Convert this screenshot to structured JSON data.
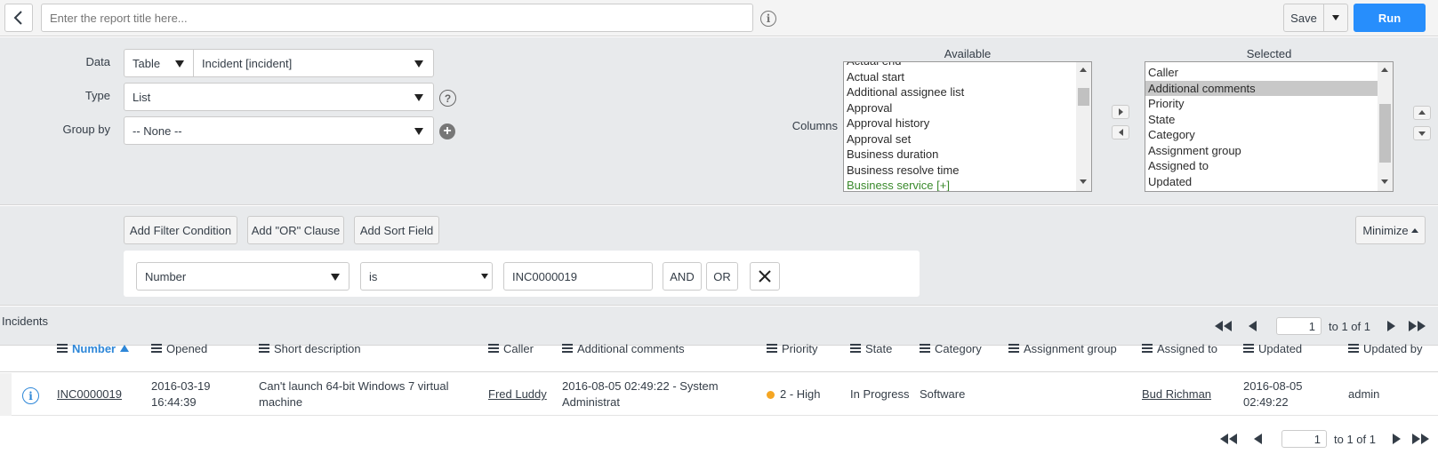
{
  "header": {
    "title_placeholder": "Enter the report title here...",
    "save_label": "Save",
    "run_label": "Run"
  },
  "colors": {
    "run_button": "#278efc",
    "priority_high": "#f5a623",
    "sort_active": "#2e87d8",
    "panel_bg": "#e8eaec"
  },
  "config": {
    "data_label": "Data",
    "data_source_type": "Table",
    "data_table": "Incident [incident]",
    "type_label": "Type",
    "type_value": "List",
    "groupby_label": "Group by",
    "groupby_value": "-- None --",
    "columns_label": "Columns",
    "available_title": "Available",
    "selected_title": "Selected",
    "available_items": [
      "Actual end",
      "Actual start",
      "Additional assignee list",
      "Approval",
      "Approval history",
      "Approval set",
      "Business duration",
      "Business resolve time",
      "Business service [+]"
    ],
    "selected_items": [
      "Caller",
      "Additional comments",
      "Priority",
      "State",
      "Category",
      "Assignment group",
      "Assigned to",
      "Updated"
    ],
    "selected_highlight": "Additional comments"
  },
  "filter": {
    "add_condition": "Add Filter Condition",
    "add_or": "Add \"OR\" Clause",
    "add_sort": "Add Sort Field",
    "minimize": "Minimize",
    "field": "Number",
    "operator": "is",
    "value": "INC0000019",
    "and_label": "AND",
    "or_label": "OR"
  },
  "list": {
    "title": "Incidents",
    "page": "1",
    "page_of": "to 1 of 1",
    "columns": [
      "Number",
      "Opened",
      "Short description",
      "Caller",
      "Additional comments",
      "Priority",
      "State",
      "Category",
      "Assignment group",
      "Assigned to",
      "Updated",
      "Updated by"
    ],
    "row": {
      "number": "INC0000019",
      "opened_date": "2016-03-19",
      "opened_time": "16:44:39",
      "short_desc_1": "Can't launch 64-bit Windows 7 virtual",
      "short_desc_2": "machine",
      "caller": "Fred Luddy",
      "comments_1": "2016-08-05 02:49:22 - System",
      "comments_2": "Administrat",
      "priority": "2 - High",
      "state": "In Progress",
      "category": "Software",
      "assignment_group": "",
      "assigned_to": "Bud Richman",
      "updated_date": "2016-08-05",
      "updated_time": "02:49:22",
      "updated_by": "admin"
    }
  }
}
